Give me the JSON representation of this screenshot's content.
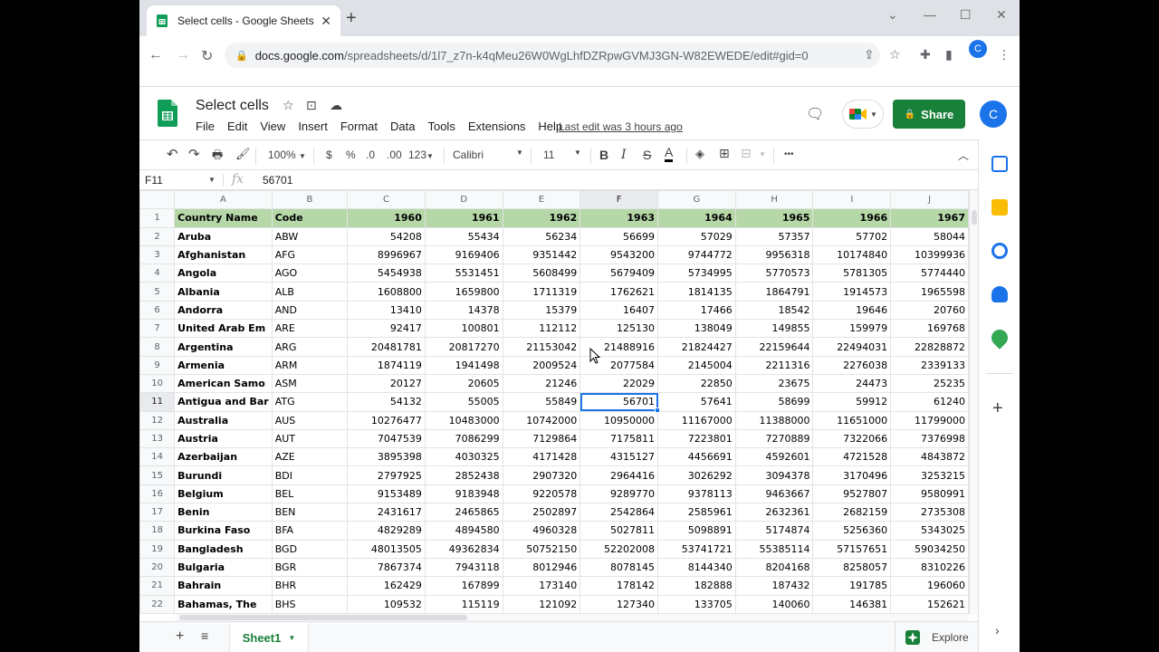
{
  "browser": {
    "tab_title": "Select cells - Google Sheets",
    "url_host": "docs.google.com",
    "url_path": "/spreadsheets/d/1l7_z7n-k4qMeu26W0WgLhfDZRpwGVMJ3GN-W82EWEDE/edit#gid=0",
    "profile_initial": "C"
  },
  "doc": {
    "title": "Select cells",
    "menus": [
      "File",
      "Edit",
      "View",
      "Insert",
      "Format",
      "Data",
      "Tools",
      "Extensions",
      "Help"
    ],
    "last_edit": "Last edit was 3 hours ago",
    "share_label": "Share",
    "avatar_initial": "C"
  },
  "toolbar": {
    "zoom": "100%",
    "currency": "$",
    "percent": "%",
    "dec_less": ".0",
    "dec_more": ".00",
    "more_formats": "123",
    "font": "Calibri",
    "font_size": "11",
    "bold": "B",
    "italic": "I",
    "strike": "S",
    "text_color": "A",
    "more": "•••"
  },
  "formula_bar": {
    "name_box": "F11",
    "fx": "fx",
    "value": "56701"
  },
  "grid": {
    "columns": [
      "A",
      "B",
      "C",
      "D",
      "E",
      "F",
      "G",
      "H",
      "I",
      "J"
    ],
    "selected_column": "F",
    "selected_row": 11,
    "rows": [
      {
        "n": "1",
        "cells": [
          "Country Name",
          "Code",
          "1960",
          "1961",
          "1962",
          "1963",
          "1964",
          "1965",
          "1966",
          "1967"
        ]
      },
      {
        "n": "2",
        "cells": [
          "Aruba",
          "ABW",
          "54208",
          "55434",
          "56234",
          "56699",
          "57029",
          "57357",
          "57702",
          "58044"
        ]
      },
      {
        "n": "3",
        "cells": [
          "Afghanistan",
          "AFG",
          "8996967",
          "9169406",
          "9351442",
          "9543200",
          "9744772",
          "9956318",
          "10174840",
          "10399936"
        ]
      },
      {
        "n": "4",
        "cells": [
          "Angola",
          "AGO",
          "5454938",
          "5531451",
          "5608499",
          "5679409",
          "5734995",
          "5770573",
          "5781305",
          "5774440"
        ]
      },
      {
        "n": "5",
        "cells": [
          "Albania",
          "ALB",
          "1608800",
          "1659800",
          "1711319",
          "1762621",
          "1814135",
          "1864791",
          "1914573",
          "1965598"
        ]
      },
      {
        "n": "6",
        "cells": [
          "Andorra",
          "AND",
          "13410",
          "14378",
          "15379",
          "16407",
          "17466",
          "18542",
          "19646",
          "20760"
        ]
      },
      {
        "n": "7",
        "cells": [
          "United Arab Em",
          "ARE",
          "92417",
          "100801",
          "112112",
          "125130",
          "138049",
          "149855",
          "159979",
          "169768"
        ]
      },
      {
        "n": "8",
        "cells": [
          "Argentina",
          "ARG",
          "20481781",
          "20817270",
          "21153042",
          "21488916",
          "21824427",
          "22159644",
          "22494031",
          "22828872"
        ]
      },
      {
        "n": "9",
        "cells": [
          "Armenia",
          "ARM",
          "1874119",
          "1941498",
          "2009524",
          "2077584",
          "2145004",
          "2211316",
          "2276038",
          "2339133"
        ]
      },
      {
        "n": "10",
        "cells": [
          "American Samo",
          "ASM",
          "20127",
          "20605",
          "21246",
          "22029",
          "22850",
          "23675",
          "24473",
          "25235"
        ]
      },
      {
        "n": "11",
        "cells": [
          "Antigua and Bar",
          "ATG",
          "54132",
          "55005",
          "55849",
          "56701",
          "57641",
          "58699",
          "59912",
          "61240"
        ]
      },
      {
        "n": "12",
        "cells": [
          "Australia",
          "AUS",
          "10276477",
          "10483000",
          "10742000",
          "10950000",
          "11167000",
          "11388000",
          "11651000",
          "11799000"
        ]
      },
      {
        "n": "13",
        "cells": [
          "Austria",
          "AUT",
          "7047539",
          "7086299",
          "7129864",
          "7175811",
          "7223801",
          "7270889",
          "7322066",
          "7376998"
        ]
      },
      {
        "n": "14",
        "cells": [
          "Azerbaijan",
          "AZE",
          "3895398",
          "4030325",
          "4171428",
          "4315127",
          "4456691",
          "4592601",
          "4721528",
          "4843872"
        ]
      },
      {
        "n": "15",
        "cells": [
          "Burundi",
          "BDI",
          "2797925",
          "2852438",
          "2907320",
          "2964416",
          "3026292",
          "3094378",
          "3170496",
          "3253215"
        ]
      },
      {
        "n": "16",
        "cells": [
          "Belgium",
          "BEL",
          "9153489",
          "9183948",
          "9220578",
          "9289770",
          "9378113",
          "9463667",
          "9527807",
          "9580991"
        ]
      },
      {
        "n": "17",
        "cells": [
          "Benin",
          "BEN",
          "2431617",
          "2465865",
          "2502897",
          "2542864",
          "2585961",
          "2632361",
          "2682159",
          "2735308"
        ]
      },
      {
        "n": "18",
        "cells": [
          "Burkina Faso",
          "BFA",
          "4829289",
          "4894580",
          "4960328",
          "5027811",
          "5098891",
          "5174874",
          "5256360",
          "5343025"
        ]
      },
      {
        "n": "19",
        "cells": [
          "Bangladesh",
          "BGD",
          "48013505",
          "49362834",
          "50752150",
          "52202008",
          "53741721",
          "55385114",
          "57157651",
          "59034250"
        ]
      },
      {
        "n": "20",
        "cells": [
          "Bulgaria",
          "BGR",
          "7867374",
          "7943118",
          "8012946",
          "8078145",
          "8144340",
          "8204168",
          "8258057",
          "8310226"
        ]
      },
      {
        "n": "21",
        "cells": [
          "Bahrain",
          "BHR",
          "162429",
          "167899",
          "173140",
          "178142",
          "182888",
          "187432",
          "191785",
          "196060"
        ]
      },
      {
        "n": "22",
        "cells": [
          "Bahamas, The",
          "BHS",
          "109532",
          "115119",
          "121092",
          "127340",
          "133705",
          "140060",
          "146381",
          "152621"
        ]
      }
    ]
  },
  "bottom": {
    "sheet_name": "Sheet1",
    "explore_label": "Explore"
  },
  "colors": {
    "accent": "#1a73e8",
    "share": "#188038",
    "header_fill": "#b6d7a8"
  }
}
